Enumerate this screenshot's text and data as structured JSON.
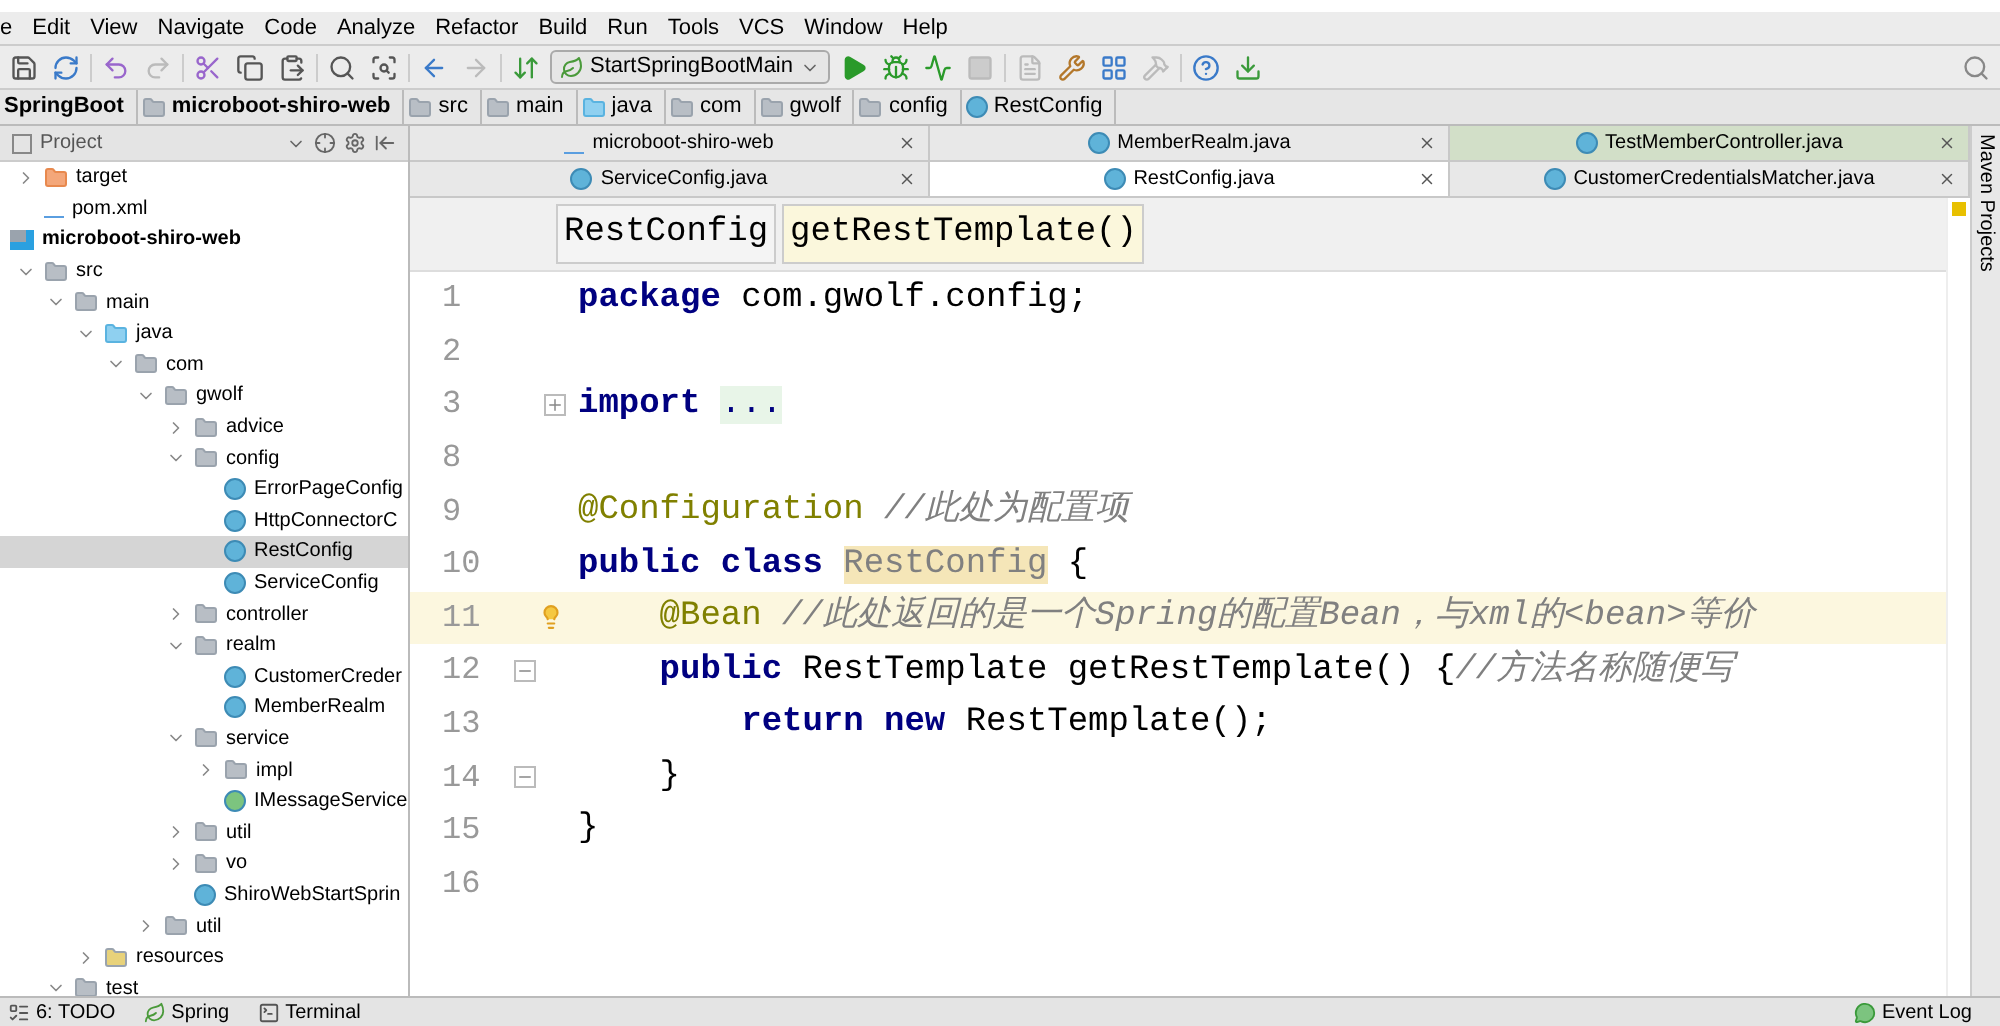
{
  "menu": [
    "e",
    "Edit",
    "View",
    "Navigate",
    "Code",
    "Analyze",
    "Refactor",
    "Build",
    "Run",
    "Tools",
    "VCS",
    "Window",
    "Help"
  ],
  "toolbar": {
    "run_config": "StartSpringBootMain"
  },
  "breadcrumb": [
    {
      "label": "SpringBoot",
      "kind": "project"
    },
    {
      "label": "microboot-shiro-web",
      "kind": "module"
    },
    {
      "label": "src",
      "kind": "folder"
    },
    {
      "label": "main",
      "kind": "folder"
    },
    {
      "label": "java",
      "kind": "source"
    },
    {
      "label": "com",
      "kind": "folder"
    },
    {
      "label": "gwolf",
      "kind": "folder"
    },
    {
      "label": "config",
      "kind": "folder"
    },
    {
      "label": "RestConfig",
      "kind": "class"
    }
  ],
  "project_panel": {
    "title": "Project",
    "tree": [
      {
        "label": "target",
        "kind": "excluded",
        "expanded": false,
        "selected": false
      },
      {
        "label": "pom.xml",
        "kind": "maven",
        "selected": false
      },
      {
        "label": "microboot-shiro-web",
        "kind": "module",
        "selected": false,
        "children": [
          {
            "label": "src",
            "kind": "folder",
            "expanded": true,
            "selected": false,
            "children": [
              {
                "label": "main",
                "kind": "folder",
                "expanded": true,
                "selected": false,
                "children": [
                  {
                    "label": "java",
                    "kind": "source",
                    "expanded": true,
                    "selected": false,
                    "children": [
                      {
                        "label": "com",
                        "kind": "folder",
                        "expanded": true,
                        "selected": false,
                        "children": [
                          {
                            "label": "gwolf",
                            "kind": "folder",
                            "expanded": true,
                            "selected": false,
                            "children": [
                              {
                                "label": "advice",
                                "kind": "folder",
                                "expanded": false,
                                "selected": false
                              },
                              {
                                "label": "config",
                                "kind": "folder",
                                "expanded": true,
                                "selected": false,
                                "children": [
                                  {
                                    "label": "ErrorPageConfig",
                                    "kind": "class",
                                    "selected": false
                                  },
                                  {
                                    "label": "HttpConnectorC",
                                    "kind": "class",
                                    "selected": false
                                  },
                                  {
                                    "label": "RestConfig",
                                    "kind": "class",
                                    "selected": true
                                  },
                                  {
                                    "label": "ServiceConfig",
                                    "kind": "class",
                                    "selected": false
                                  }
                                ]
                              },
                              {
                                "label": "controller",
                                "kind": "folder",
                                "expanded": false,
                                "selected": false
                              },
                              {
                                "label": "realm",
                                "kind": "folder",
                                "expanded": true,
                                "selected": false,
                                "children": [
                                  {
                                    "label": "CustomerCreder",
                                    "kind": "class",
                                    "selected": false
                                  },
                                  {
                                    "label": "MemberRealm",
                                    "kind": "class",
                                    "selected": false
                                  }
                                ]
                              },
                              {
                                "label": "service",
                                "kind": "folder",
                                "expanded": true,
                                "selected": false,
                                "children": [
                                  {
                                    "label": "impl",
                                    "kind": "folder",
                                    "expanded": false,
                                    "selected": false
                                  },
                                  {
                                    "label": "IMessageService",
                                    "kind": "interface",
                                    "selected": false
                                  }
                                ]
                              },
                              {
                                "label": "util",
                                "kind": "folder",
                                "expanded": false,
                                "selected": false
                              },
                              {
                                "label": "vo",
                                "kind": "folder",
                                "expanded": false,
                                "selected": false
                              },
                              {
                                "label": "ShiroWebStartSprin",
                                "kind": "main-class",
                                "selected": false
                              }
                            ]
                          },
                          {
                            "label": "util",
                            "kind": "folder",
                            "expanded": false,
                            "selected": false
                          }
                        ]
                      }
                    ]
                  },
                  {
                    "label": "resources",
                    "kind": "resources",
                    "expanded": false,
                    "selected": false
                  }
                ]
              },
              {
                "label": "test",
                "kind": "folder",
                "expanded": true,
                "selected": false
              }
            ]
          }
        ]
      }
    ]
  },
  "editor_tabs": [
    [
      {
        "label": "microboot-shiro-web",
        "kind": "maven",
        "selected": false
      },
      {
        "label": "MemberRealm.java",
        "kind": "class",
        "selected": false
      },
      {
        "label": "TestMemberController.java",
        "kind": "test",
        "selected": false
      }
    ],
    [
      {
        "label": "ServiceConfig.java",
        "kind": "class",
        "selected": false
      },
      {
        "label": "RestConfig.java",
        "kind": "class",
        "selected": true
      },
      {
        "label": "CustomerCredentialsMatcher.java",
        "kind": "class",
        "selected": false
      }
    ]
  ],
  "structure_path": [
    {
      "label": "RestConfig",
      "selected": false
    },
    {
      "label": "getRestTemplate()",
      "selected": true
    }
  ],
  "code": [
    {
      "number": "1",
      "current": false,
      "kind": "plain",
      "tokens": [
        {
          "kind": "keyword",
          "text": "package"
        },
        {
          "kind": "plain",
          "text": "com.gwolf.config;"
        }
      ]
    },
    {
      "number": "2",
      "current": false,
      "kind": "plain"
    },
    {
      "number": "3",
      "current": false,
      "kind": "fold-expand",
      "tokens": [
        {
          "kind": "import",
          "text": "import"
        },
        {
          "kind": "folded",
          "text": "..."
        }
      ]
    },
    {
      "number": "8",
      "current": false,
      "kind": "plain"
    },
    {
      "number": "9",
      "current": false,
      "kind": "plain",
      "tokens": [
        {
          "kind": "annotation",
          "text": "@Configuration"
        },
        {
          "kind": "comment",
          "text": "//此处为配置项"
        }
      ]
    },
    {
      "number": "10",
      "current": false,
      "kind": "plain",
      "tokens": [
        {
          "kind": "keyword",
          "text": "public class"
        },
        {
          "kind": "unused",
          "text": "RestConfig"
        },
        {
          "kind": "plain",
          "text": "{"
        }
      ]
    },
    {
      "number": "11",
      "current": true,
      "kind": "plain",
      "tokens": [
        {
          "kind": "annotation",
          "text": "    @Bean"
        },
        {
          "kind": "comment",
          "text": "//此处返回的是一个Spring的配置Bean，与xml的<bean>等价"
        }
      ]
    },
    {
      "number": "12",
      "current": false,
      "kind": "fold-start",
      "tokens": [
        {
          "kind": "keyword",
          "text": "    public"
        },
        {
          "kind": "plain",
          "text": "RestTemplate getRestTemplate() {"
        },
        {
          "kind": "comment",
          "text": "//方法名称随便写",
          "attached": true
        }
      ]
    },
    {
      "number": "13",
      "current": false,
      "kind": "plain",
      "tokens": [
        {
          "kind": "keyword",
          "text": "        return new"
        },
        {
          "kind": "plain",
          "text": "RestTemplate();"
        }
      ]
    },
    {
      "number": "14",
      "current": false,
      "kind": "fold-end",
      "tokens": [
        {
          "kind": "plain",
          "text": "    }"
        }
      ]
    },
    {
      "number": "15",
      "current": false,
      "kind": "plain",
      "tokens": [
        {
          "kind": "plain",
          "text": "}"
        }
      ]
    },
    {
      "number": "16",
      "current": false,
      "kind": "plain"
    }
  ],
  "right_strip": {
    "label": "Maven Projects"
  },
  "status_bar": {
    "items": [
      {
        "label": "6: TODO",
        "kind": "todo"
      },
      {
        "label": "Spring",
        "kind": "spring"
      },
      {
        "label": "Terminal",
        "kind": "terminal"
      }
    ],
    "event_log": "Event Log"
  }
}
